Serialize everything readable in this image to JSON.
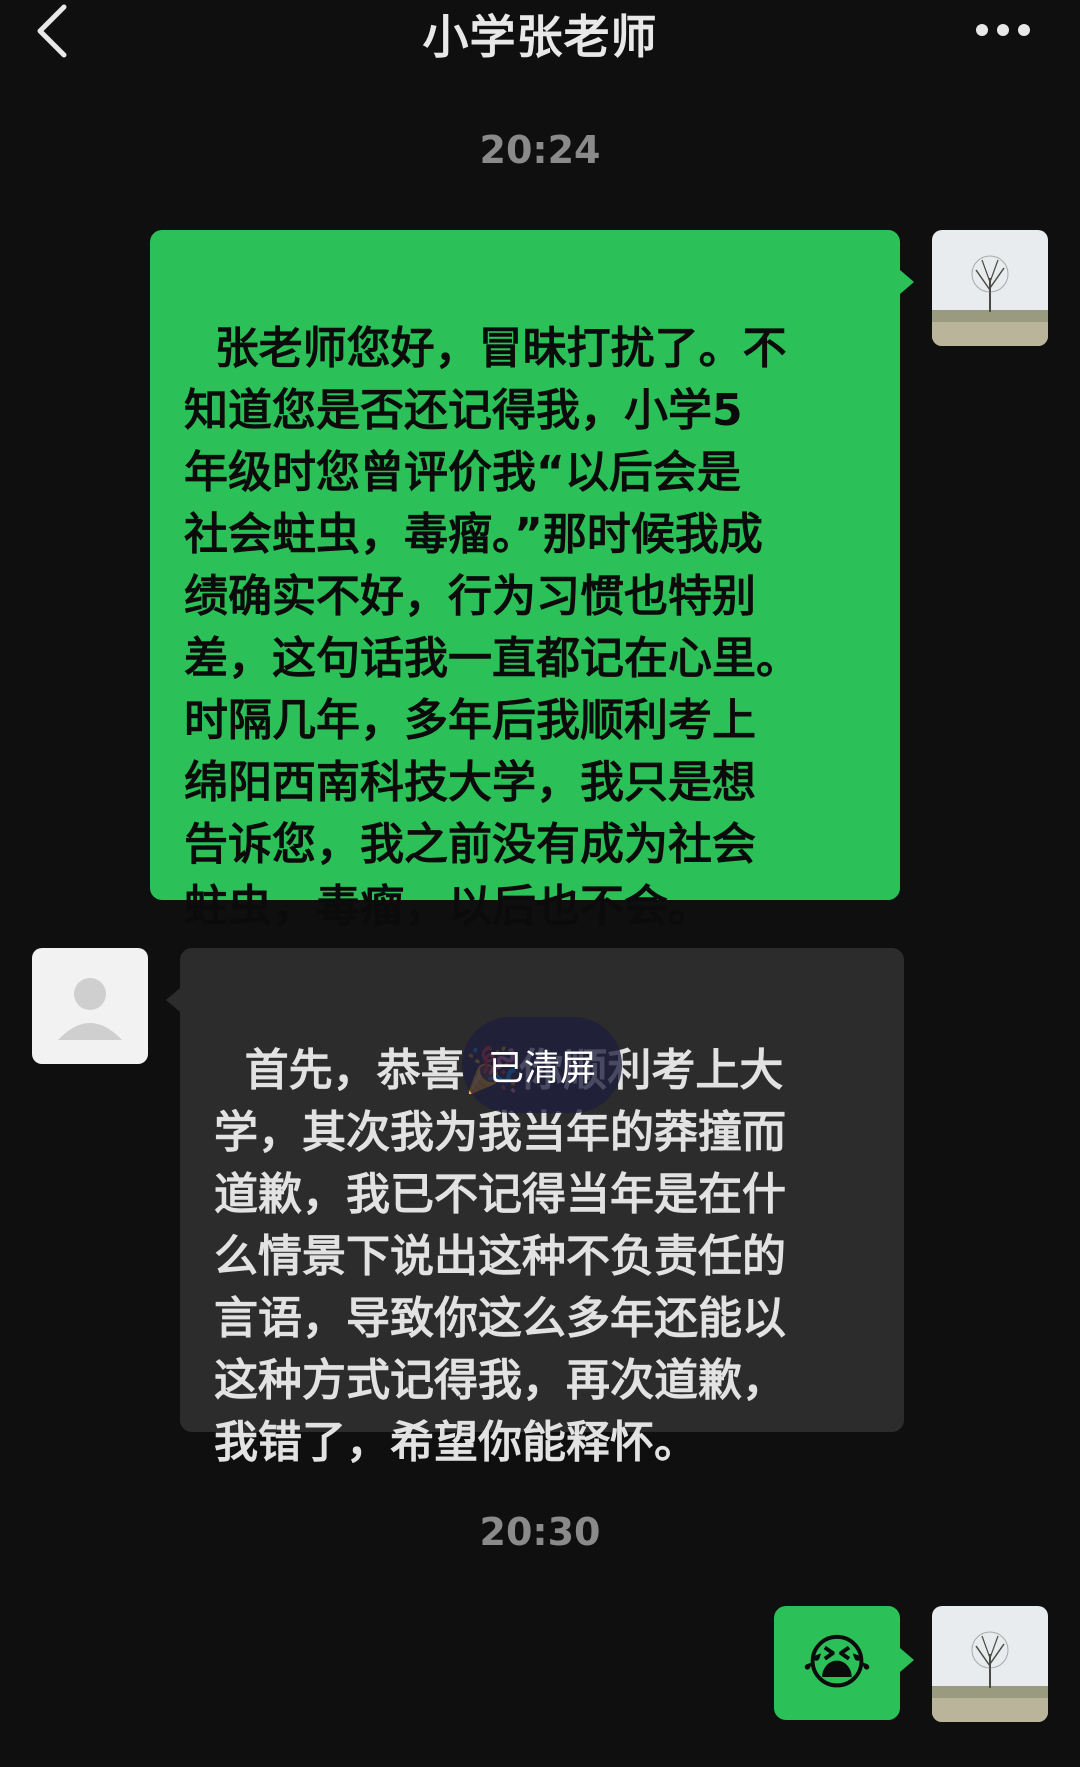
{
  "header": {
    "title": "小学张老师",
    "back_icon": "chevron-left-icon",
    "more_icon": "more-dots-icon"
  },
  "timestamps": [
    "20:24",
    "20:30"
  ],
  "messages": [
    {
      "sender": "self",
      "text": "张老师您好，冒昧打扰了。不\n知道您是否还记得我，小学5\n年级时您曾评价我“以后会是\n社会蛀虫，毒瘤。”那时候我成\n绩确实不好，行为习惯也特别\n差，这句话我一直都记在心里。\n时隔几年，多年后我顺利考上\n绵阳西南科技大学，我只是想\n告诉您，我之前没有成为社会\n蛀虫，毒瘤，以后也不会。"
    },
    {
      "sender": "teacher",
      "text": "首先，恭喜🎉你顺利考上大\n学，其次我为我当年的莽撞而\n道歉，我已不记得当年是在什\n么情景下说出这种不负责任的\n言语，导致你这么多年还能以\n这种方式记得我，再次道歉，\n我错了，希望你能释怀。"
    },
    {
      "sender": "self",
      "text": "😭"
    }
  ],
  "overlay": {
    "cleared_label": "已清屏"
  },
  "colors": {
    "self_bubble": "#2bc158",
    "other_bubble": "#2c2c2c",
    "background": "#0f0f0f"
  }
}
